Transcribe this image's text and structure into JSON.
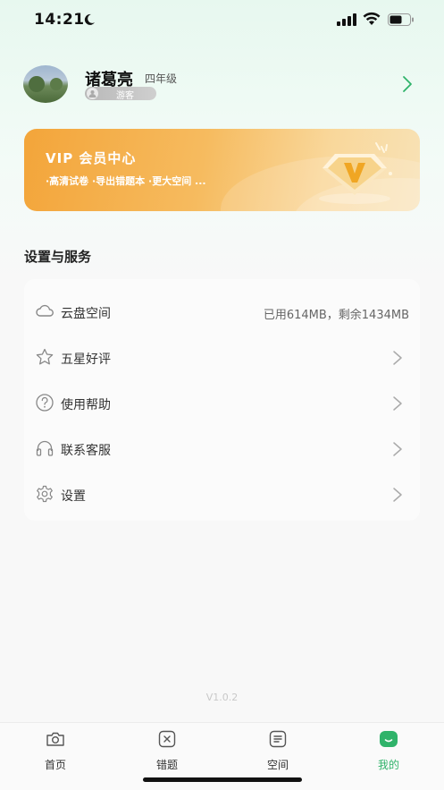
{
  "status_bar": {
    "time": "14:21"
  },
  "profile": {
    "name": "诸葛亮",
    "grade": "四年级",
    "badge": "游客"
  },
  "vip": {
    "title": "VIP 会员中心",
    "subtitle": "·高清试卷 ·导出错题本 ·更大空间 ..."
  },
  "settings": {
    "section_title": "设置与服务",
    "items": [
      {
        "label": "云盘空间",
        "value": "已用614MB，剩余1434MB",
        "icon": "cloud-icon"
      },
      {
        "label": "五星好评",
        "icon": "star-icon"
      },
      {
        "label": "使用帮助",
        "icon": "help-icon"
      },
      {
        "label": "联系客服",
        "icon": "headphones-icon"
      },
      {
        "label": "设置",
        "icon": "gear-icon"
      }
    ]
  },
  "version": "V1.0.2",
  "tabs": [
    {
      "label": "首页",
      "icon": "camera-icon",
      "active": false
    },
    {
      "label": "错题",
      "icon": "wrong-question-icon",
      "active": false
    },
    {
      "label": "空间",
      "icon": "space-icon",
      "active": false
    },
    {
      "label": "我的",
      "icon": "smile-icon",
      "active": true
    }
  ],
  "colors": {
    "accent": "#2fb36a",
    "vip_orange": "#f3a53a"
  }
}
